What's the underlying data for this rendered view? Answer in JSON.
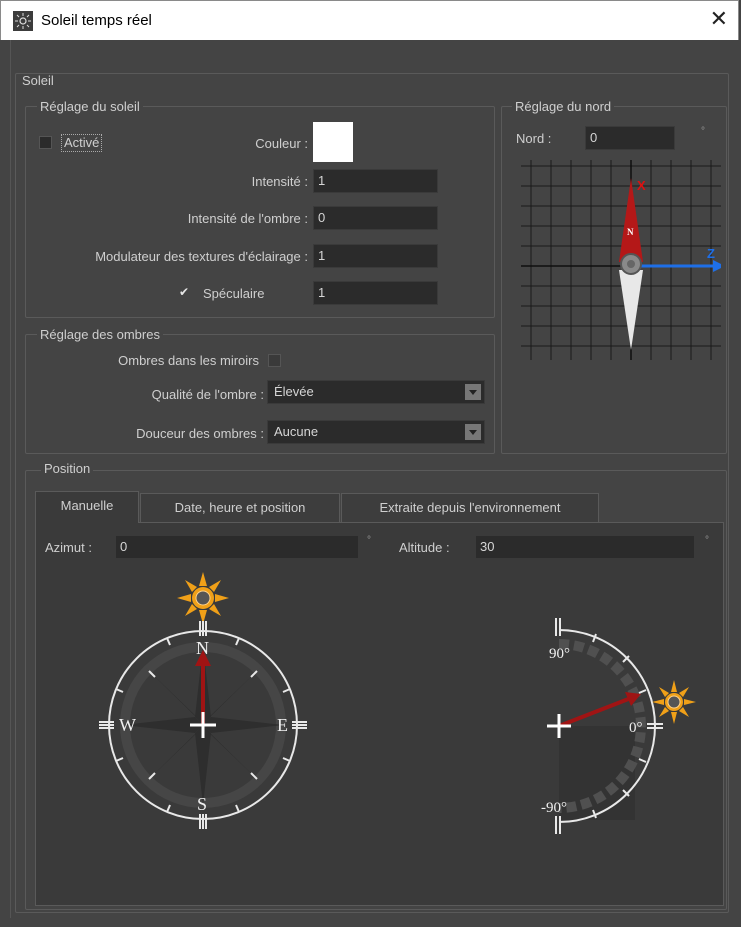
{
  "window": {
    "title": "Soleil temps réel",
    "close_glyph": "✕",
    "app_icon": "sun-settings-icon"
  },
  "sun_group": {
    "legend": "Soleil"
  },
  "sun_settings": {
    "legend": "Réglage du soleil",
    "active_label": "Activé",
    "active_checked": false,
    "color_label": "Couleur :",
    "color_value": "#ffffff",
    "intensity_label": "Intensité :",
    "intensity_value": "1",
    "shadow_intensity_label": "Intensité de l'ombre :",
    "shadow_intensity_value": "0",
    "modulator_label": "Modulateur des textures d'éclairage :",
    "modulator_value": "1",
    "specular_label": "Spéculaire",
    "specular_checked": true,
    "specular_value": "1"
  },
  "north_settings": {
    "legend": "Réglage du nord",
    "north_label": "Nord :",
    "north_value": "0",
    "north_unit": "°",
    "axis_x": "X",
    "axis_z": "Z",
    "needle_letter": "N"
  },
  "shadow_settings": {
    "legend": "Réglage des ombres",
    "mirror_label": "Ombres dans les miroirs",
    "mirror_checked": false,
    "quality_label": "Qualité de l'ombre :",
    "quality_value": "Élevée",
    "softness_label": "Douceur des ombres :",
    "softness_value": "Aucune"
  },
  "position": {
    "legend": "Position",
    "tabs": [
      "Manuelle",
      "Date, heure et position",
      "Extraite depuis l'environnement"
    ],
    "active_tab": "Manuelle",
    "azimuth_label": "Azimut :",
    "azimuth_value": "0",
    "azimuth_unit": "°",
    "altitude_label": "Altitude :",
    "altitude_value": "30",
    "altitude_unit": "°",
    "compass": {
      "n": "N",
      "s": "S",
      "e": "E",
      "w": "W"
    },
    "altitude_dial": {
      "top": "90°",
      "mid": "0°",
      "bottom": "-90°"
    }
  },
  "colors": {
    "accent_red": "#b41818",
    "axis_blue": "#1e6fe8",
    "sun_orange": "#f0a018",
    "panel_bg": "#444444",
    "field_bg": "#2b2b2b"
  }
}
